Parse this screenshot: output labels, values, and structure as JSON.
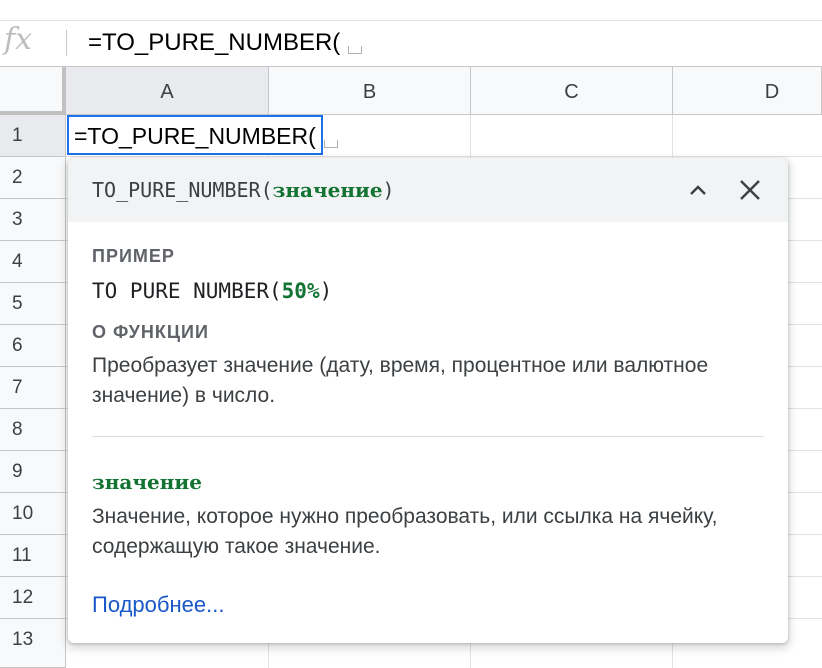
{
  "formula_bar": {
    "fx_label": "fx",
    "formula": "=TO_PURE_NUMBER("
  },
  "columns": [
    "A",
    "B",
    "C",
    "D"
  ],
  "rows": [
    "1",
    "2",
    "3",
    "4",
    "5",
    "6",
    "7",
    "8",
    "9",
    "10",
    "11",
    "12",
    "13"
  ],
  "active_cell": {
    "ref": "A1",
    "text": "=TO_PURE_NUMBER("
  },
  "tooltip": {
    "signature_prefix": "TO_PURE_NUMBER(",
    "signature_arg": "значение",
    "signature_suffix": ")",
    "example_title": "ПРИМЕР",
    "example_prefix": "TO PURE NUMBER(",
    "example_arg": "50%",
    "example_suffix": ")",
    "about_title": "О ФУНКЦИИ",
    "about_text": "Преобразует значение (дату, время, процентное или валютное значение) в число.",
    "param_name": "значение",
    "param_desc": "Значение, которое нужно преобразовать, или ссылка на ячейку, содержащую такое значение.",
    "learn_more": "Подробнее..."
  },
  "colors": {
    "accent": "#1a73e8",
    "arg_green": "#137333",
    "link": "#1a57c8"
  }
}
